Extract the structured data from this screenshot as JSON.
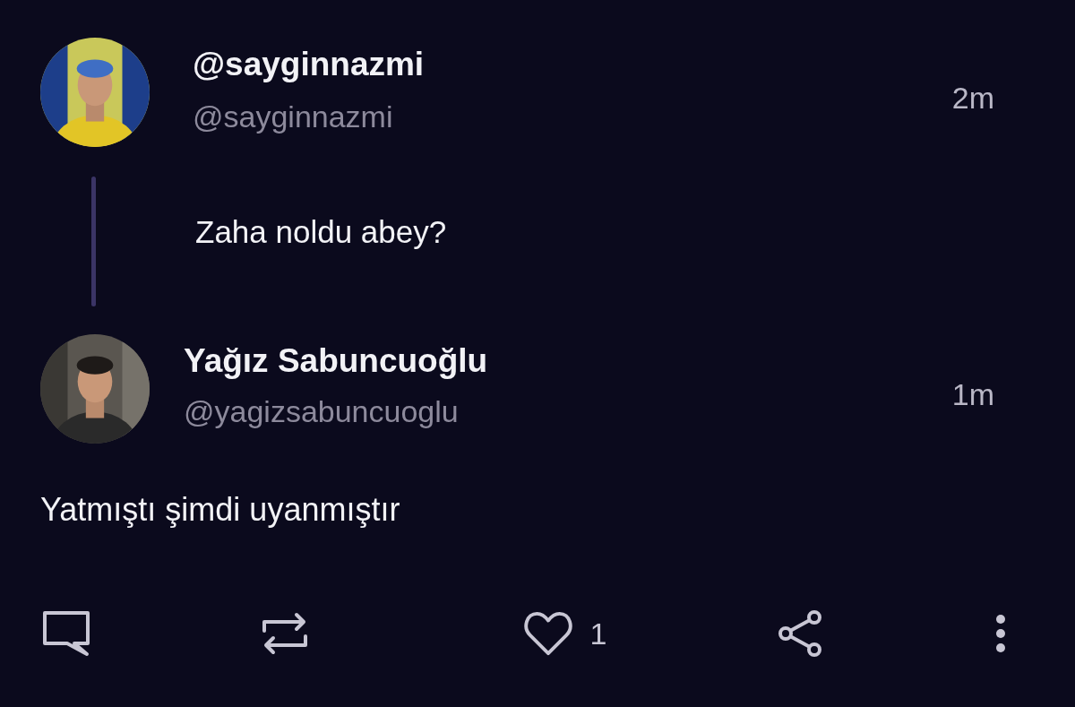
{
  "posts": [
    {
      "kind": "parent",
      "name": "@sayginnazmi",
      "handle": "@sayginnazmi",
      "time": "2m",
      "text": "Zaha noldu abey?"
    },
    {
      "kind": "reply",
      "name": "Yağız Sabuncuoğlu",
      "handle": "@yagizsabuncuoglu",
      "time": "1m",
      "text": "Yatmıştı şimdi uyanmıştır"
    }
  ],
  "actions": {
    "like_count": "1"
  }
}
